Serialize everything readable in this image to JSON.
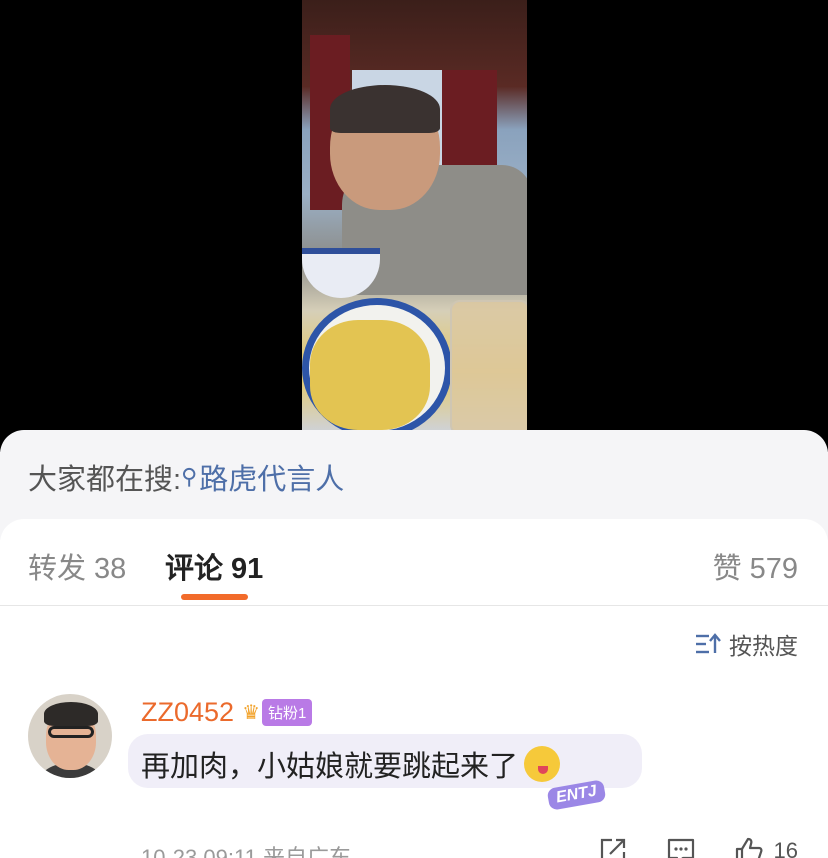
{
  "search_hint": {
    "prefix": "大家都在搜:",
    "keyword": "路虎代言人"
  },
  "tabs": [
    {
      "label": "转发",
      "count": "38"
    },
    {
      "label": "评论",
      "count": "91"
    },
    {
      "label": "赞",
      "count": "579"
    }
  ],
  "sort": {
    "label": "按热度"
  },
  "comment": {
    "username": "ZZ0452",
    "fan_badge": "钻粉1",
    "text": "再加肉，小姑娘就要跳起来了",
    "decoration_text": "ENTJ",
    "time": "10-23 09:11",
    "source": "来自广东",
    "like_count": "16"
  },
  "colors": {
    "accent": "#f26b2a",
    "username": "#eb6a2c",
    "link": "#4e6fa8",
    "badge": "#b97ae6"
  },
  "icons": [
    "search-icon",
    "sort-icon",
    "share-icon",
    "comment-icon",
    "like-icon",
    "crown-icon",
    "emoji-icon"
  ]
}
